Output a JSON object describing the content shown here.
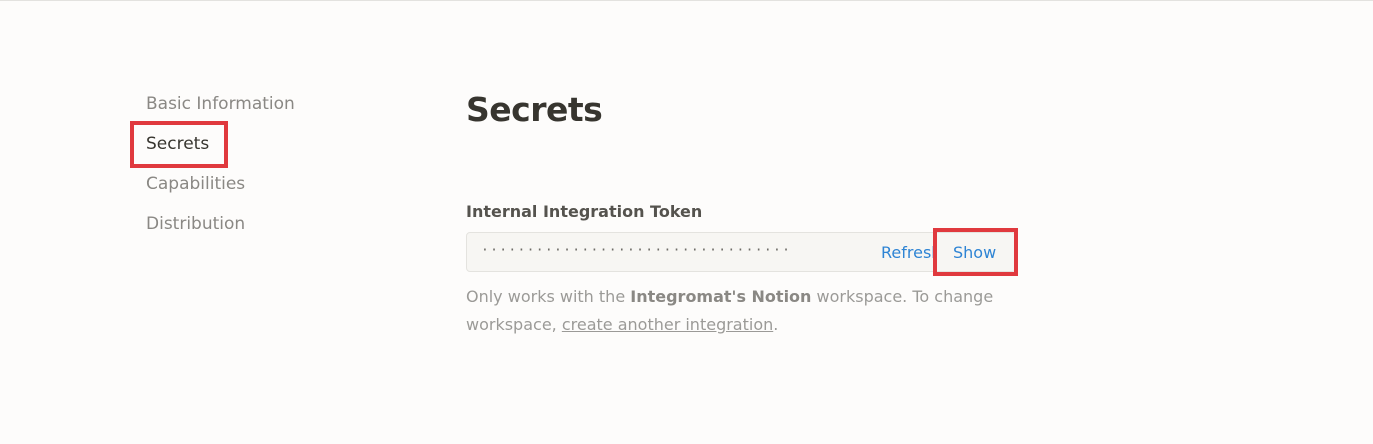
{
  "sidebar": {
    "items": [
      {
        "label": "Basic Information"
      },
      {
        "label": "Secrets"
      },
      {
        "label": "Capabilities"
      },
      {
        "label": "Distribution"
      }
    ],
    "active_index": 1
  },
  "main": {
    "title": "Secrets",
    "token": {
      "label": "Internal Integration Token",
      "masked_value": "··································",
      "refresh_label": "Refresh",
      "show_label": "Show"
    },
    "help": {
      "prefix": "Only works with the ",
      "workspace_name": "Integromat's Notion",
      "middle": " workspace. To change workspace, ",
      "link_text": "create another integration",
      "suffix": "."
    }
  },
  "colors": {
    "accent_link": "#2e84d4",
    "highlight": "#e0393e",
    "text_primary": "#37352f",
    "text_muted": "#9b9a97",
    "background": "#fdfcfb"
  }
}
